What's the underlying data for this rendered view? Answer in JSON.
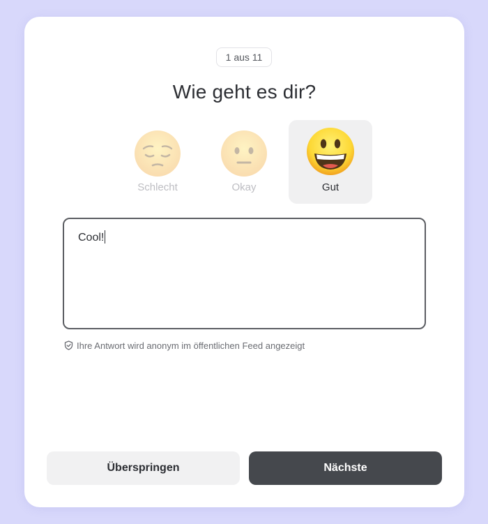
{
  "step_badge": "1 aus 11",
  "question": "Wie geht es dir?",
  "moods": [
    {
      "label": "Schlecht",
      "icon": "pensive-face-icon",
      "selected": false
    },
    {
      "label": "Okay",
      "icon": "neutral-face-icon",
      "selected": false
    },
    {
      "label": "Gut",
      "icon": "grinning-face-icon",
      "selected": true
    }
  ],
  "response": {
    "value": "Cool!"
  },
  "notice": {
    "icon": "shield-check-icon",
    "text": "Ihre Antwort wird anonym im öffentlichen Feed angezeigt"
  },
  "buttons": {
    "skip_label": "Überspringen",
    "next_label": "Nächste"
  },
  "colors": {
    "background": "#d8d8fb",
    "primary_button": "#45484d",
    "secondary_button": "#f1f1f2",
    "selected_mood_bg": "#f0f0f1",
    "emoji_yellow": "#fdd835"
  }
}
